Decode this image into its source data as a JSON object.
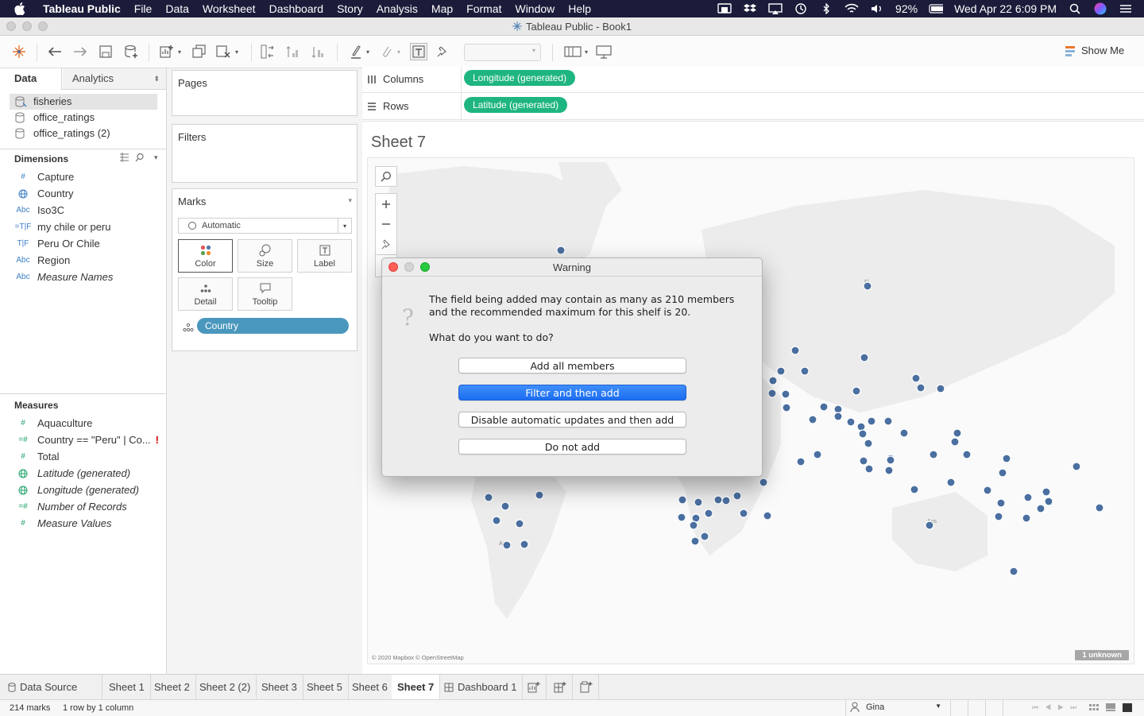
{
  "menubar": {
    "app_name": "Tableau Public",
    "items": [
      "File",
      "Data",
      "Worksheet",
      "Dashboard",
      "Story",
      "Analysis",
      "Map",
      "Format",
      "Window",
      "Help"
    ],
    "battery": "92%",
    "datetime": "Wed Apr 22  6:09 PM"
  },
  "window": {
    "title": "Tableau Public - Book1"
  },
  "toolbar": {
    "show_me_label": "Show Me"
  },
  "data_pane": {
    "tabs": {
      "data": "Data",
      "analytics": "Analytics"
    },
    "datasources": [
      "fisheries",
      "office_ratings",
      "office_ratings (2)"
    ],
    "dimensions_title": "Dimensions",
    "dimensions": [
      {
        "icon": "#",
        "label": "Capture"
      },
      {
        "icon": "globe",
        "label": "Country"
      },
      {
        "icon": "Abc",
        "label": "Iso3C"
      },
      {
        "icon": "=T|F",
        "label": "my chile or peru"
      },
      {
        "icon": "T|F",
        "label": "Peru Or Chile"
      },
      {
        "icon": "Abc",
        "label": "Region"
      },
      {
        "icon": "Abc",
        "label": "Measure Names"
      }
    ],
    "measures_title": "Measures",
    "measures": [
      {
        "icon": "#",
        "label": "Aquaculture"
      },
      {
        "icon": "=#",
        "label": "Country == \"Peru\" | Co...",
        "warning": "!"
      },
      {
        "icon": "#",
        "label": "Total"
      },
      {
        "icon": "globe",
        "label": "Latitude (generated)"
      },
      {
        "icon": "globe",
        "label": "Longitude (generated)"
      },
      {
        "icon": "=#",
        "label": "Number of Records"
      },
      {
        "icon": "#",
        "label": "Measure Values"
      }
    ]
  },
  "cards": {
    "pages": "Pages",
    "filters": "Filters",
    "marks": "Marks",
    "mark_type": "Automatic",
    "mark_buttons": [
      "Color",
      "Size",
      "Label",
      "Detail",
      "Tooltip"
    ],
    "marks_pill": "Country"
  },
  "shelves": {
    "columns_label": "Columns",
    "columns_pill": "Longitude (generated)",
    "rows_label": "Rows",
    "rows_pill": "Latitude (generated)"
  },
  "view": {
    "sheet_title": "Sheet 7",
    "attribution": "© 2020 Mapbox © OpenStreetMap",
    "unknown_badge": "1 unknown",
    "map_labels": [
      "Fi",
      "Aus",
      "Ar"
    ]
  },
  "dialog": {
    "title": "Warning",
    "message_line1": "The field being added may contain as many as 210 members",
    "message_line2": "and the recommended maximum for this shelf is 20.",
    "question": "What do you want to do?",
    "buttons": {
      "add_all": "Add all members",
      "filter_add": "Filter and then add",
      "disable_updates": "Disable automatic updates and then add",
      "do_not_add": "Do not add"
    }
  },
  "sheet_tabs": {
    "data_source": "Data Source",
    "sheets": [
      "Sheet 1",
      "Sheet 2",
      "Sheet 2 (2)",
      "Sheet 3",
      "Sheet 5",
      "Sheet 6",
      "Sheet 7"
    ],
    "active": "Sheet 7",
    "dashboard": "Dashboard 1"
  },
  "status": {
    "marks": "214 marks",
    "rows_cols": "1 row by 1 column",
    "user": "Gina"
  },
  "colors": {
    "menubar": "#1b1b3a",
    "pill_green": "#1fb580",
    "pill_blue": "#4a97bd",
    "mark_dot": "#4a6fa0",
    "dialog_default": "#1c6df2"
  }
}
